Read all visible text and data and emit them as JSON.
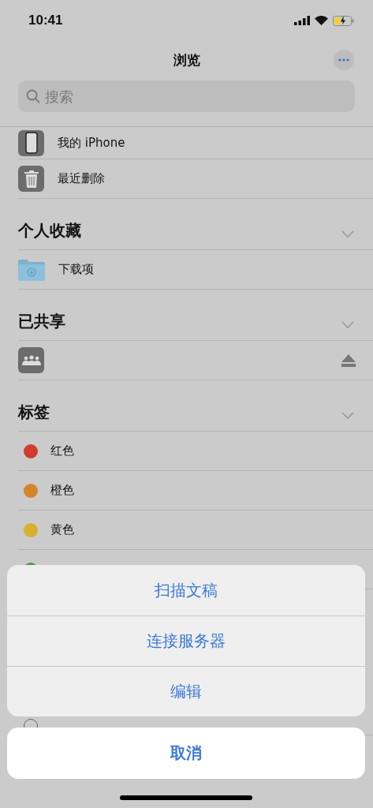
{
  "status_bar": {
    "time": "10:41"
  },
  "nav": {
    "title": "浏览",
    "search": {
      "placeholder": "搜索"
    }
  },
  "locations": [
    {
      "label": "我的 iPhone",
      "kind": "phone"
    },
    {
      "label": "最近删除",
      "kind": "trash"
    }
  ],
  "sections": [
    {
      "title": "个人收藏",
      "expanded": true,
      "items": [
        {
          "label": "下载项",
          "kind": "folder"
        }
      ]
    },
    {
      "title": "已共享",
      "expanded": true,
      "items": [
        {
          "kind": "shared",
          "eject": true
        }
      ]
    }
  ],
  "tags": {
    "title": "标签",
    "expanded": true,
    "items": [
      {
        "label": "红色",
        "color": "#d13b30"
      },
      {
        "label": "橙色",
        "color": "#d6852b"
      },
      {
        "label": "黄色",
        "color": "#d8b02e"
      },
      {
        "color": "#4d9b3c"
      }
    ],
    "trailing": {
      "kind": "hollow"
    }
  },
  "action_sheet": {
    "actions": [
      "扫描文稿",
      "连接服务器",
      "编辑"
    ],
    "cancel": "取消"
  }
}
